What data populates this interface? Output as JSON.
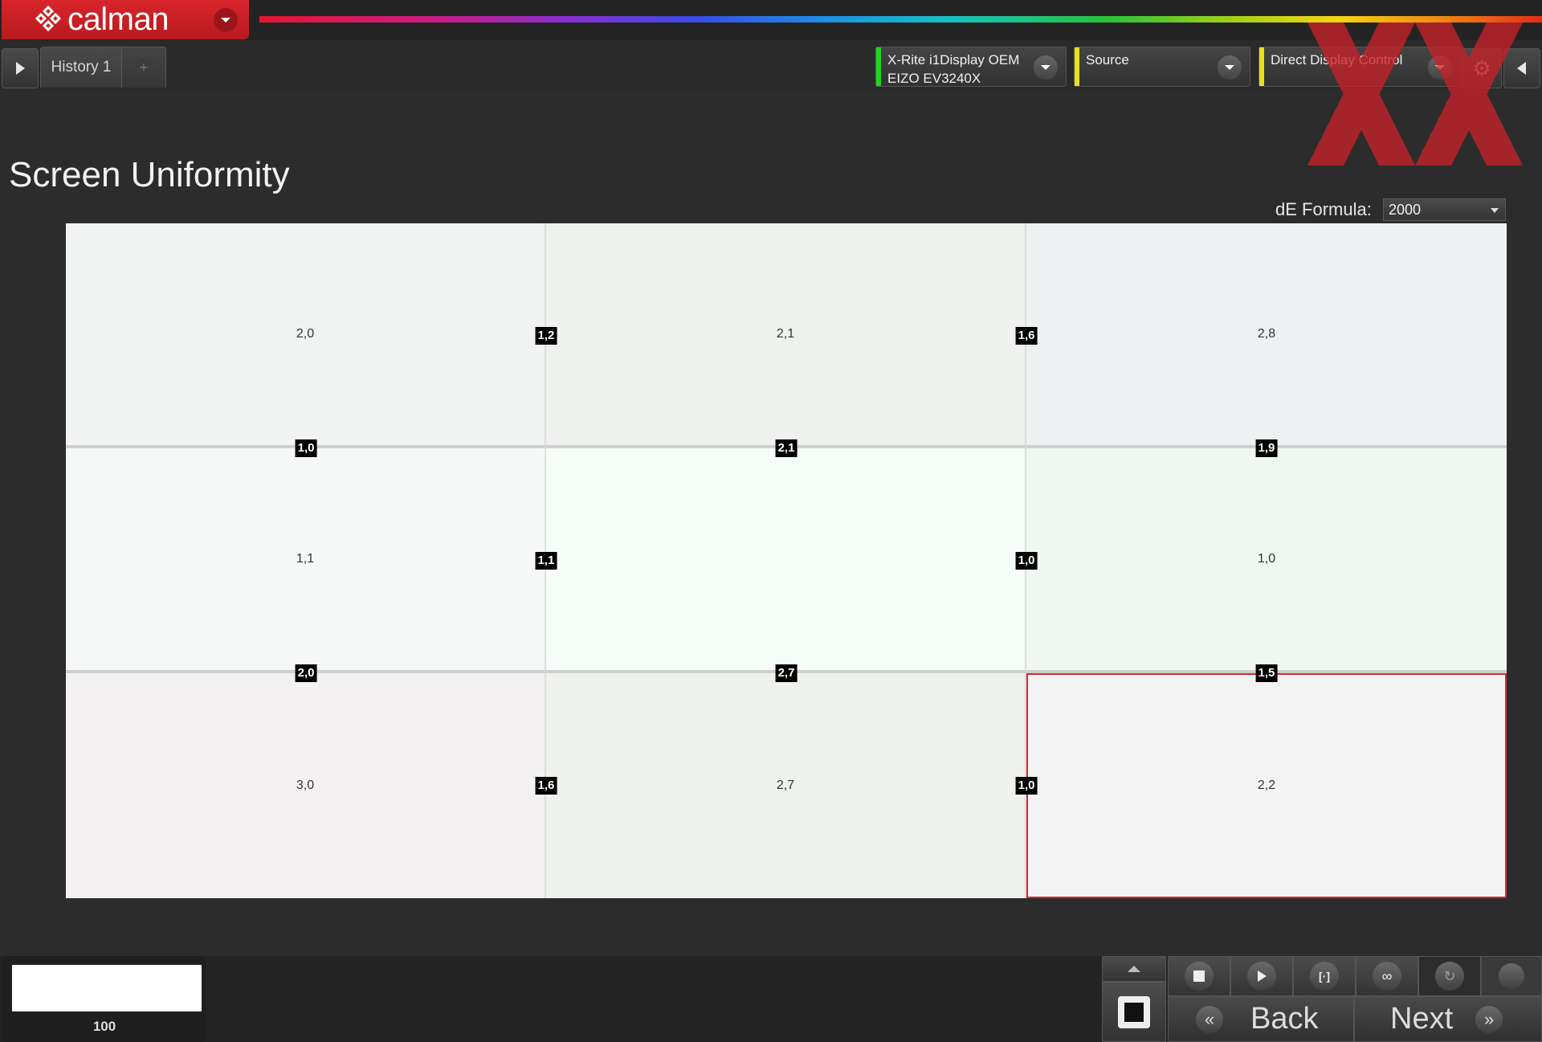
{
  "app": {
    "name": "calman",
    "accent": "#d42127"
  },
  "tabs": {
    "history": "History 1",
    "add": "+"
  },
  "devices": [
    {
      "line1": "X-Rite i1Display OEM",
      "line2": "EIZO EV3240X",
      "status_color": "#1fd61f"
    },
    {
      "line1": "Source",
      "line2": "",
      "status_color": "#e8e21a"
    },
    {
      "line1": "Direct Display Control",
      "line2": "",
      "status_color": "#e8e21a"
    }
  ],
  "page": {
    "title": "Screen Uniformity"
  },
  "de_formula": {
    "label": "dE Formula:",
    "value": "2000"
  },
  "grid": {
    "cells": [
      {
        "value": "2,0",
        "color": "#f1f2f2"
      },
      {
        "value": "2,1",
        "color": "#eef1ed"
      },
      {
        "value": "2,8",
        "color": "#eef1f2"
      },
      {
        "value": "1,1",
        "color": "#f6f7f7"
      },
      {
        "value": "",
        "color": "#f6fcf7"
      },
      {
        "value": "1,0",
        "color": "#f0f6f0"
      },
      {
        "value": "3,0",
        "color": "#f3f1f1"
      },
      {
        "value": "2,7",
        "color": "#eef1ec"
      },
      {
        "value": "2,2",
        "color": "#f3f3f4"
      }
    ],
    "selected_index": 8,
    "vertical_labels": [
      "1,2",
      "1,6",
      "1,1",
      "1,0",
      "1,6",
      "1,0"
    ],
    "horizontal_labels": [
      "1,0",
      "2,1",
      "1,9",
      "2,0",
      "2,7",
      "1,5"
    ]
  },
  "swatch": {
    "value": "100",
    "color": "#ffffff"
  },
  "nav": {
    "back": "Back",
    "next": "Next"
  },
  "controls": [
    "stop-icon",
    "play-icon",
    "measure-icon",
    "loop-icon",
    "refresh-icon",
    "record-icon"
  ]
}
